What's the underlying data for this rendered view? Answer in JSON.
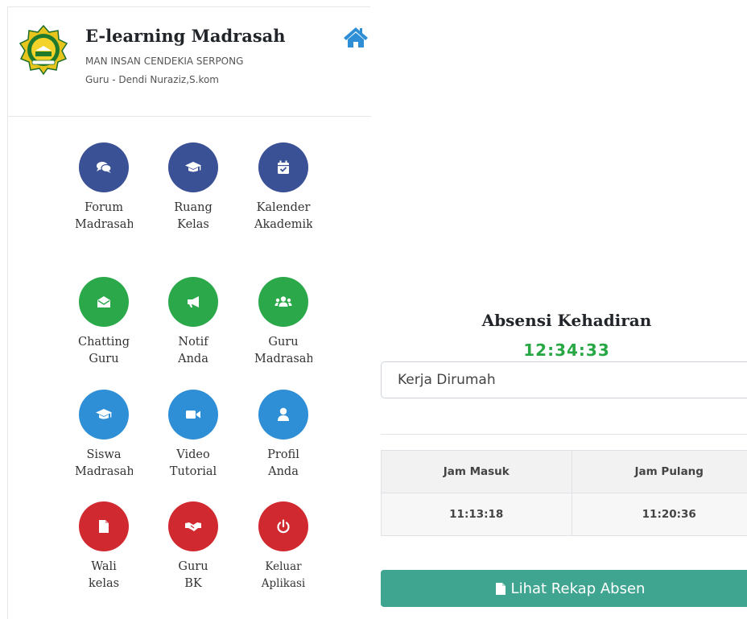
{
  "header": {
    "app_title": "E-learning Madrasah",
    "school_name": "MAN INSAN CENDEKIA SERPONG",
    "user_line": "Guru - Dendi Nuraziz,S.kom"
  },
  "menu": [
    {
      "line1": "Forum",
      "line2": "Madrasah",
      "icon": "comments-icon",
      "color": "#3a5196"
    },
    {
      "line1": "Ruang",
      "line2": "Kelas",
      "icon": "graduation-cap-icon",
      "color": "#3a5196"
    },
    {
      "line1": "Kalender",
      "line2": "Akademik",
      "icon": "calendar-check-icon",
      "color": "#3a5196"
    },
    {
      "line1": "Chatting",
      "line2": "Guru",
      "icon": "envelope-open-icon",
      "color": "#2ba84a"
    },
    {
      "line1": "Notif",
      "line2": "Anda",
      "icon": "bullhorn-icon",
      "color": "#2ba84a"
    },
    {
      "line1": "Guru",
      "line2": "Madrasah",
      "icon": "users-icon",
      "color": "#2ba84a"
    },
    {
      "line1": "Siswa",
      "line2": "Madrasah",
      "icon": "graduation-cap-icon",
      "color": "#2f8fd6"
    },
    {
      "line1": "Video",
      "line2": "Tutorial",
      "icon": "video-icon",
      "color": "#2f8fd6"
    },
    {
      "line1": "Profil",
      "line2": "Anda",
      "icon": "user-icon",
      "color": "#2f8fd6"
    },
    {
      "line1": "Wali",
      "line2": "kelas",
      "icon": "file-icon",
      "color": "#d0292f"
    },
    {
      "line1": "Guru",
      "line2": "BK",
      "icon": "handshake-icon",
      "color": "#d0292f"
    },
    {
      "line1": "Keluar",
      "line2": "Aplikasi",
      "icon": "power-off-icon",
      "color": "#d0292f"
    }
  ],
  "attendance": {
    "title": "Absensi Kehadiran",
    "clock": "12:34:33",
    "mode_value": "Kerja Dirumah",
    "table_headers": [
      "Jam Masuk",
      "Jam Pulang"
    ],
    "table_values": [
      "11:13:18",
      "11:20:36"
    ],
    "rekap_button": "Lihat Rekap Absen"
  }
}
